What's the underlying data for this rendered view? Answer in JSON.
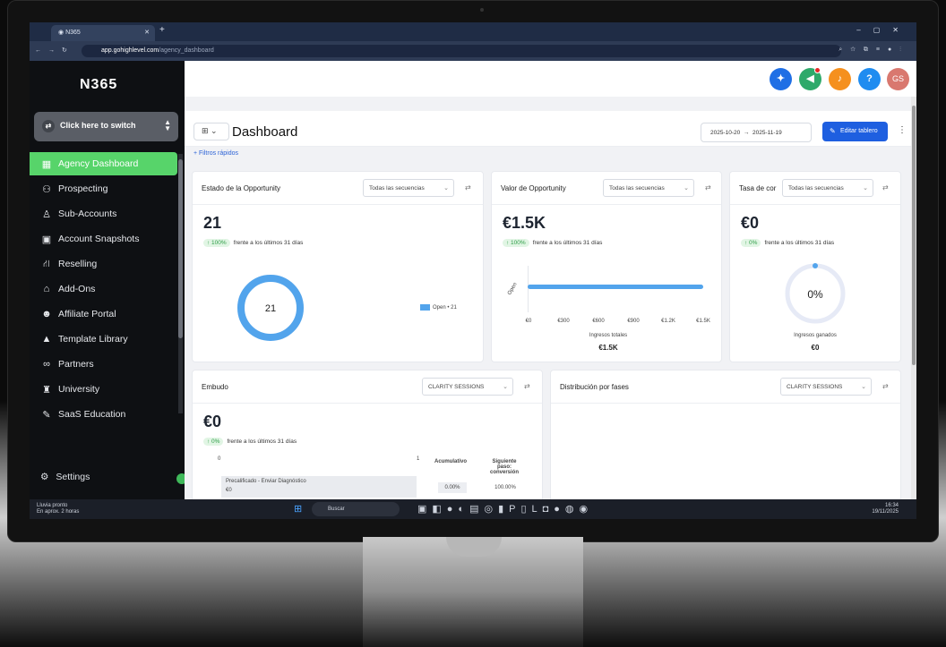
{
  "browser": {
    "tab_title": "N365",
    "url_host": "app.gohighlevel.com",
    "url_path": "/agency_dashboard"
  },
  "sidebar": {
    "logo": "N365",
    "switch_label": "Click here to switch",
    "items": [
      {
        "label": "Agency Dashboard",
        "icon": "dashboard-icon",
        "glyph": "▦"
      },
      {
        "label": "Prospecting",
        "icon": "users-icon",
        "glyph": "⚇"
      },
      {
        "label": "Sub-Accounts",
        "icon": "user-icon",
        "glyph": "♙"
      },
      {
        "label": "Account Snapshots",
        "icon": "image-icon",
        "glyph": "▣"
      },
      {
        "label": "Reselling",
        "icon": "network-icon",
        "glyph": "⛙"
      },
      {
        "label": "Add-Ons",
        "icon": "bag-icon",
        "glyph": "⌂"
      },
      {
        "label": "Affiliate Portal",
        "icon": "people-icon",
        "glyph": "☻"
      },
      {
        "label": "Template Library",
        "icon": "stack-icon",
        "glyph": "▲"
      },
      {
        "label": "Partners",
        "icon": "handshake-icon",
        "glyph": "∞"
      },
      {
        "label": "University",
        "icon": "graduation-cap-icon",
        "glyph": "♜"
      },
      {
        "label": "SaaS Education",
        "icon": "education-icon",
        "glyph": "✎"
      }
    ],
    "settings_label": "Settings"
  },
  "topbar": {
    "avatar": "GS",
    "colors": {
      "blue": "#1f6fe5",
      "green": "#2ea96a",
      "orange": "#f5901e",
      "help": "#1f8cf0",
      "avatar": "#d9786f"
    }
  },
  "dashboard": {
    "title": "Dashboard",
    "date_from": "2025-10-20",
    "date_to": "2025-11-19",
    "edit_label": "Editar tablero",
    "quick_filters": "+ Filtros rápidos",
    "cards": {
      "opportunity_status": {
        "title": "Estado de la Opportunity",
        "select": "Todas las secuencias",
        "value": "21",
        "pct": "↑ 100%",
        "compare": "frente a los últimos 31 días",
        "donut_value": "21",
        "legend": "Open • 21"
      },
      "opportunity_value": {
        "title": "Valor de Opportunity",
        "select": "Todas las secuencias",
        "value": "€1.5K",
        "pct": "↑ 100%",
        "compare": "frente a los últimos 31 días",
        "bar_label": "Open",
        "ticks": [
          "€0",
          "€300",
          "€600",
          "€900",
          "€1.2K",
          "€1.5K"
        ],
        "axis_label": "Ingresos totales",
        "total": "€1.5K"
      },
      "conversion_rate": {
        "title": "Tasa de cor",
        "select": "Todas las secuencias",
        "value": "€0",
        "pct": "↑ 0%",
        "compare": "frente a los últimos 31 días",
        "gauge": "0%",
        "gauge_label": "Ingresos ganados",
        "total": "€0"
      },
      "funnel": {
        "title": "Embudo",
        "select": "CLARITY SESSIONS",
        "value": "€0",
        "pct": "↑ 0%",
        "compare": "frente a los últimos 31 días",
        "col_zero": "0",
        "col_one": "1",
        "col_acum": "Acumulativo",
        "col_next": "Siguiente paso: conversión",
        "stage": "Precalificado - Enviar Diagnóstico",
        "stage_value": "€0",
        "acum_value": "0.00%",
        "next_value": "100.00%"
      },
      "stage_distribution": {
        "title": "Distribución por fases",
        "select": "CLARITY SESSIONS"
      }
    }
  },
  "taskbar": {
    "weather_title": "Lluvia pronto",
    "weather_sub": "En aprox. 2 horas",
    "search": "Buscar",
    "time": "16:34",
    "date": "19/11/2025"
  }
}
